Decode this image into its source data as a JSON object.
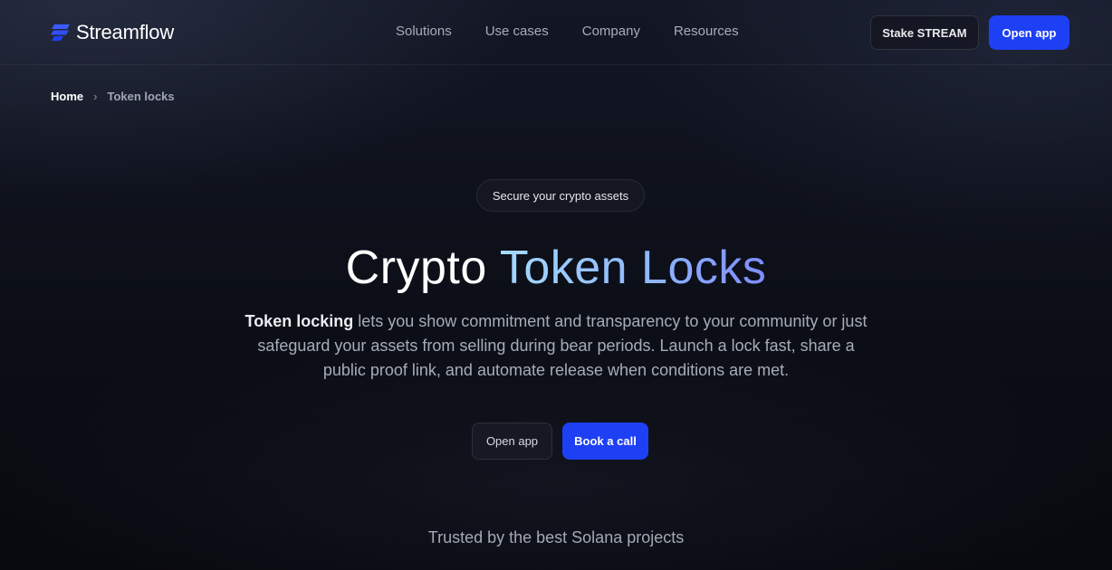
{
  "brand": {
    "name": "Streamflow",
    "accent": "#1e40f5"
  },
  "nav": {
    "items": [
      {
        "label": "Solutions"
      },
      {
        "label": "Use cases"
      },
      {
        "label": "Company"
      },
      {
        "label": "Resources"
      }
    ]
  },
  "header": {
    "stake_label": "Stake STREAM",
    "open_app_label": "Open app"
  },
  "breadcrumb": {
    "home": "Home",
    "separator": "›",
    "current": "Token locks"
  },
  "hero": {
    "pill": "Secure your crypto assets",
    "title_plain": "Crypto ",
    "title_accent": "Token Locks",
    "description_lead": "Token locking",
    "description_rest": " lets you show commitment and transparency to your community or just safeguard your assets from selling during bear periods. Launch a lock fast, share a public proof link, and automate release when conditions are met.",
    "open_app_label": "Open app",
    "book_call_label": "Book a call"
  },
  "trusted": {
    "text": "Trusted by the best Solana projects"
  },
  "icons": {
    "logo": "streamflow-logo-icon",
    "breadcrumb_separator": "chevron-right-icon"
  }
}
